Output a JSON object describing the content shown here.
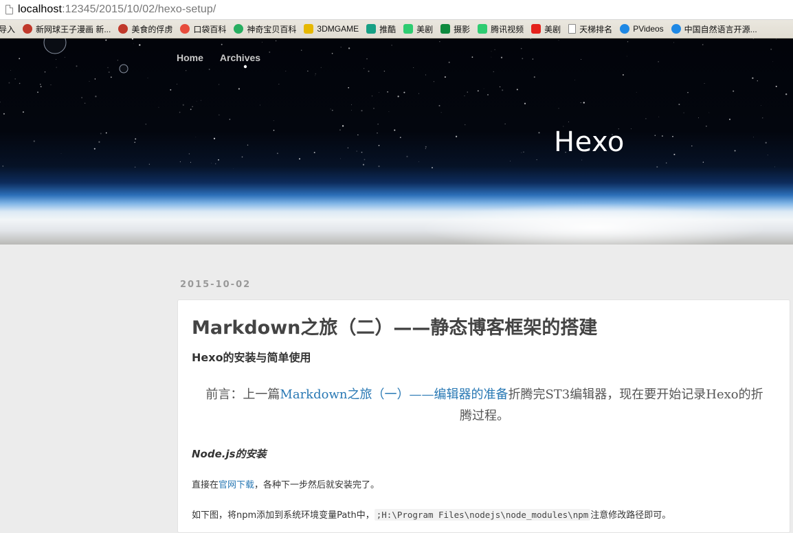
{
  "browser": {
    "url_host": "localhost",
    "url_rest": ":12345/2015/10/02/hexo-setup/"
  },
  "bookmarks": [
    {
      "label": "导入",
      "icon": "import-icon",
      "color": "#d9a520"
    },
    {
      "label": "新网球王子漫画 新...",
      "icon": "manga-icon",
      "color": "#c0392b"
    },
    {
      "label": "美食的俘虏",
      "icon": "manga-icon",
      "color": "#c0392b"
    },
    {
      "label": "口袋百科",
      "icon": "pokeball-icon",
      "color": "#e74c3c"
    },
    {
      "label": "神奇宝贝百科",
      "icon": "pokeball-icon",
      "color": "#27ae60"
    },
    {
      "label": "3DMGAME",
      "icon": "game-icon",
      "color": "#e6b800"
    },
    {
      "label": "推酷",
      "icon": "tuicool-icon",
      "color": "#16a085"
    },
    {
      "label": "美剧",
      "icon": "play-icon",
      "color": "#2ecc71"
    },
    {
      "label": "摄影",
      "icon": "zhihu-icon",
      "color": "#0e8a3e"
    },
    {
      "label": "腾讯视频",
      "icon": "play-icon",
      "color": "#2ecc71"
    },
    {
      "label": "美剧",
      "icon": "letv-icon",
      "color": "#e4211b"
    },
    {
      "label": "天梯排名",
      "icon": "document-icon",
      "color": "#ffffff"
    },
    {
      "label": "PVideos",
      "icon": "headphones-icon",
      "color": "#1e88e5"
    },
    {
      "label": "中国自然语言开源...",
      "icon": "blue-circle-icon",
      "color": "#1e88e5"
    }
  ],
  "nav": {
    "home": "Home",
    "archives": "Archives"
  },
  "site": {
    "title": "Hexo"
  },
  "post": {
    "date": "2015-10-02",
    "title": "Markdown之旅（二）——静态博客框架的搭建",
    "subtitle": "Hexo的安装与简单使用",
    "quote_prefix": "前言：上一篇",
    "quote_link": "Markdown之旅（一）——编辑器的准备",
    "quote_suffix": "折腾完ST3编辑器，现在要开始记录Hexo的折腾过程。",
    "heading_node": "Node.js的安装",
    "p1_prefix": "直接在",
    "p1_link": "官网下载",
    "p1_suffix": "，各种下一步然后就安装完了。",
    "p2_prefix": "如下图，将npm添加到系统环境变量Path中，",
    "p2_code": ";H:\\Program Files\\nodejs\\node_modules\\npm",
    "p2_suffix": "注意修改路径即可。"
  }
}
